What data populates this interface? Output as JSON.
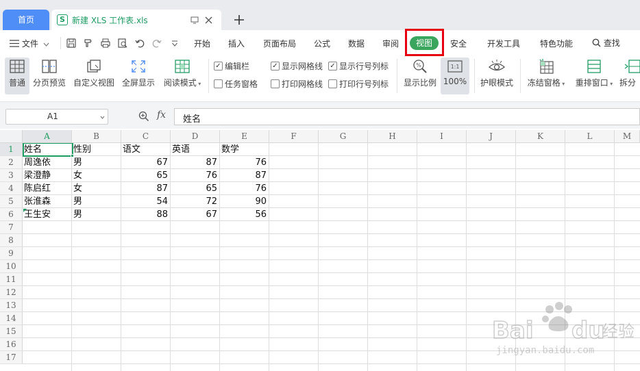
{
  "tabs": {
    "home": "首页",
    "file_name": "新建 XLS 工作表.xls"
  },
  "menu": {
    "file": "文件",
    "items": [
      "开始",
      "插入",
      "页面布局",
      "公式",
      "数据",
      "审阅",
      "视图",
      "安全",
      "开发工具",
      "特色功能"
    ],
    "active": "视图",
    "search": "查找"
  },
  "ribbon": {
    "normal": "普通",
    "page_break_preview": "分页预览",
    "custom_view": "自定义视图",
    "full_screen": "全屏显示",
    "reading_mode": "阅读模式",
    "zoom_ratio": "显示比例",
    "zoom_100": "100%",
    "eye_protection": "护眼模式",
    "freeze_panes": "冻结窗格",
    "rearrange_windows": "重排窗口",
    "split": "拆分",
    "checkboxes": {
      "edit_bar": {
        "label": "编辑栏",
        "checked": true
      },
      "task_pane": {
        "label": "任务窗格",
        "checked": false
      },
      "show_gridlines": {
        "label": "显示网格线",
        "checked": true
      },
      "print_gridlines": {
        "label": "打印网格线",
        "checked": false
      },
      "show_headers": {
        "label": "显示行号列标",
        "checked": true
      },
      "print_headers": {
        "label": "打印行号列标",
        "checked": false
      }
    }
  },
  "formula_bar": {
    "cell_ref": "A1",
    "fx": "fx",
    "content": "姓名"
  },
  "sheet": {
    "columns": [
      "A",
      "B",
      "C",
      "D",
      "E",
      "F",
      "G",
      "H",
      "I",
      "J",
      "K",
      "L",
      "M"
    ],
    "rows": [
      "1",
      "2",
      "3",
      "4",
      "5",
      "6",
      "7",
      "8",
      "9",
      "10",
      "11",
      "12",
      "13",
      "14",
      "15",
      "16",
      "17"
    ],
    "header": [
      "姓名",
      "性别",
      "语文",
      "英语",
      "数学"
    ],
    "data": [
      [
        "周逸依",
        "男",
        "67",
        "87",
        "76"
      ],
      [
        "梁澄静",
        "女",
        "65",
        "76",
        "87"
      ],
      [
        "陈启红",
        "女",
        "87",
        "65",
        "76"
      ],
      [
        "张淮森",
        "男",
        "54",
        "72",
        "90"
      ],
      [
        "王生安",
        "男",
        "88",
        "67",
        "56"
      ]
    ]
  },
  "watermark": {
    "brand": "Bai du 经验",
    "url": "jingyan.baidu.com"
  },
  "colors": {
    "accent_green": "#1f9d63",
    "view_tab_bg": "#3aa55d",
    "highlight_box": "#e60012",
    "home_tab": "#4f8ef7"
  }
}
